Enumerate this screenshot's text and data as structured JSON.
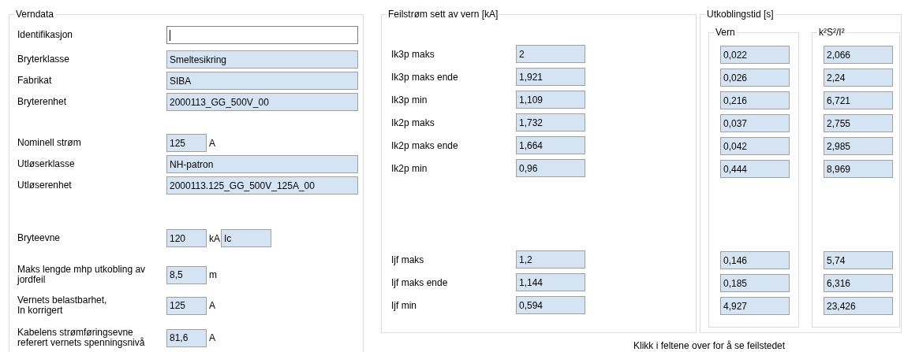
{
  "verndata": {
    "title": "Verndata",
    "groups": [
      [
        {
          "label": "Identifikasjon",
          "kind": "input",
          "focused": true
        },
        {
          "label": "Bryterklasse",
          "kind": "readonly",
          "value": "Smeltesikring"
        },
        {
          "label": "Fabrikat",
          "kind": "readonly",
          "value": "SIBA"
        },
        {
          "label": "Bryterenhet",
          "kind": "readonly",
          "value": "2000113_GG_500V_00"
        }
      ],
      [
        {
          "label": "Nominell strøm",
          "kind": "short",
          "value": "125",
          "unit": "A"
        },
        {
          "label": "Utløserklasse",
          "kind": "readonly",
          "value": "NH-patron"
        },
        {
          "label": "Utløserenhet",
          "kind": "readonly",
          "value": "2000113.125_GG_500V_125A_00"
        }
      ],
      [
        {
          "label": "Bryteevne",
          "kind": "short",
          "value": "120",
          "unit": "kA",
          "extra": "Ic"
        },
        {
          "label": "Maks lengde mhp utkobling av jordfeil",
          "kind": "short",
          "value": "8,5",
          "unit": "m"
        },
        {
          "label": "Vernets belastbarhet,\nIn korrigert",
          "kind": "short",
          "value": "125",
          "unit": "A"
        },
        {
          "label": "Kabelens strømføringsevne\nreferert vernets spenningsnivå",
          "kind": "short",
          "value": "81,6",
          "unit": "A"
        }
      ]
    ]
  },
  "feilstrom": {
    "title": "Feilstrøm sett av vern [kA]",
    "groups": [
      [
        {
          "label": "Ik3p maks",
          "value": "2"
        },
        {
          "label": "Ik3p maks ende",
          "value": "1,921"
        },
        {
          "label": "Ik3p min",
          "value": "1,109"
        },
        {
          "label": "Ik2p maks",
          "value": "1,732"
        },
        {
          "label": "Ik2p maks ende",
          "value": "1,664"
        },
        {
          "label": "Ik2p min",
          "value": "0,96"
        }
      ],
      [
        {
          "label": "Ijf maks",
          "value": "1,2"
        },
        {
          "label": "Ijf maks ende",
          "value": "1,144"
        },
        {
          "label": "Ijf min",
          "value": "0,594"
        }
      ]
    ]
  },
  "utkoblingstid": {
    "title": "Utkoblingstid [s]",
    "columns": [
      {
        "title": "Vern",
        "groups": [
          [
            "0,022",
            "0,026",
            "0,216",
            "0,037",
            "0,042",
            "0,444"
          ],
          [
            "0,146",
            "0,185",
            "4,927"
          ]
        ]
      },
      {
        "title": "k²S²/I²",
        "groups": [
          [
            "2,066",
            "2,24",
            "6,721",
            "2,755",
            "2,985",
            "8,969"
          ],
          [
            "5,74",
            "6,316",
            "23,426"
          ]
        ]
      }
    ]
  },
  "hint": "Klikk i feltene over for å se feilstedet"
}
